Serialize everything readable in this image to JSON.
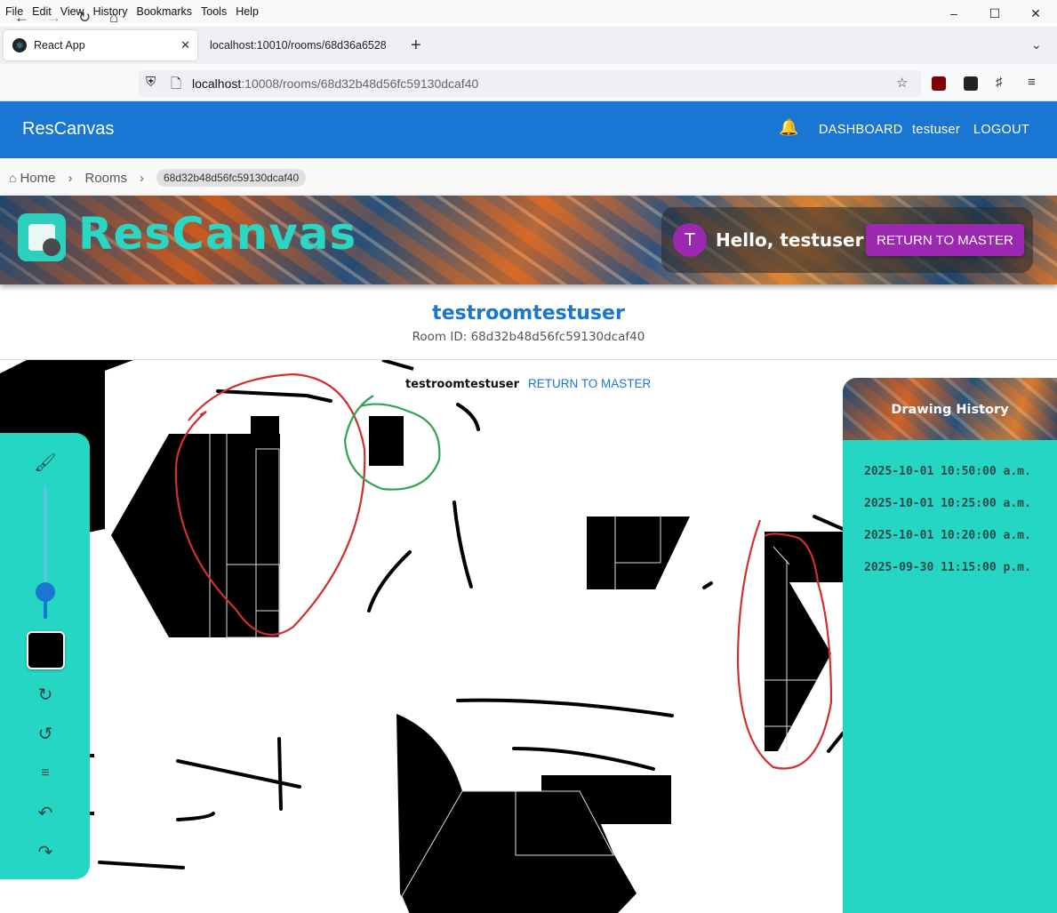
{
  "browser": {
    "menu": [
      "File",
      "Edit",
      "View",
      "History",
      "Bookmarks",
      "Tools",
      "Help"
    ],
    "tabs": [
      {
        "title": "React App",
        "active": true
      },
      {
        "title": "localhost:10010/rooms/68d36a6528",
        "active": false
      }
    ],
    "url": {
      "host": "localhost",
      "rest": ":10008/rooms/68d32b48d56fc59130dcaf40"
    }
  },
  "appbar": {
    "brand": "ResCanvas",
    "dashboard": "DASHBOARD",
    "user": "testuser",
    "logout": "LOGOUT"
  },
  "breadcrumb": {
    "home": "Home",
    "rooms": "Rooms",
    "current": "68d32b48d56fc59130dcaf40"
  },
  "banner": {
    "logo_text": "ResCanvas",
    "avatar_letter": "T",
    "greeting": "Hello, testuser",
    "return_button": "RETURN TO MASTER"
  },
  "room": {
    "title": "testroomtestuser",
    "id_line": "Room ID: 68d32b48d56fc59130dcaf40"
  },
  "canvas": {
    "title": "testroomtestuser",
    "return_link": "RETURN TO MASTER"
  },
  "toolbar": {
    "tools": [
      "brush-icon",
      "refresh-icon",
      "history-icon",
      "lines-icon",
      "undo-icon",
      "redo-icon"
    ],
    "brush_size_fraction": 0.2,
    "color": "#000000"
  },
  "history": {
    "title": "Drawing History",
    "items": [
      "2025-10-01 10:50:00 a.m.",
      "2025-10-01 10:25:00 a.m.",
      "2025-10-01 10:20:00 a.m.",
      "2025-09-30 11:15:00 p.m."
    ]
  },
  "colors": {
    "primary": "#1976d2",
    "accent": "#9c27b0",
    "teal": "#25d6c4"
  }
}
